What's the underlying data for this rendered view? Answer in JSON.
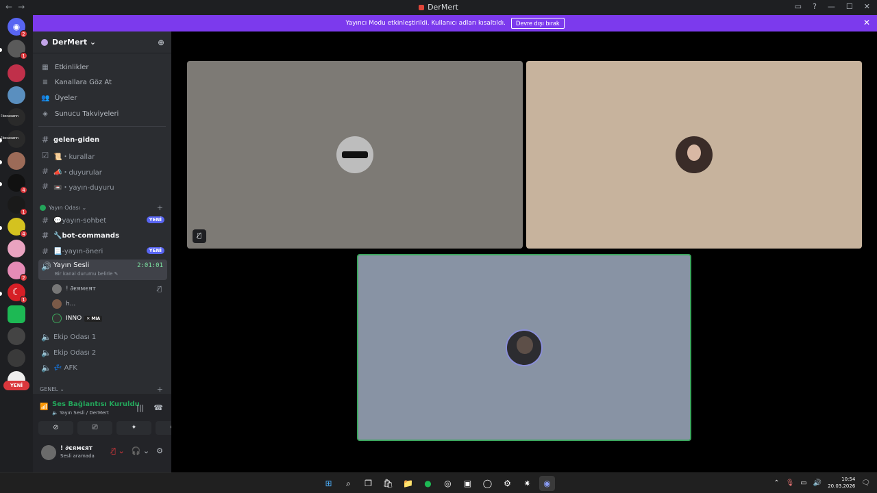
{
  "window": {
    "title": "DerMert",
    "back": "←",
    "forward": "→",
    "inbox_icon": "inbox-icon",
    "help": "?",
    "minimize": "—",
    "maximize": "☐",
    "close": "✕"
  },
  "banner": {
    "message": "Yayıncı Modu etkinleştirildi. Kullanıcı adları kısaltıldı.",
    "button": "Devre dışı bırak",
    "close": "✕",
    "color": "#7c3aed"
  },
  "servers": {
    "badges": [
      "2",
      "1",
      "4",
      "1",
      "4",
      "2",
      "1"
    ],
    "label_small": "ﾐkocasann",
    "label_small2": "ﾐkocasann",
    "yeni": "YENİ"
  },
  "guild": {
    "name": "DerMert ⌄",
    "add_user_icon": "add-user-icon"
  },
  "nav": [
    {
      "icon": "▦",
      "label": "Etkinlikler"
    },
    {
      "icon": "≣",
      "label": "Kanallara Göz At"
    },
    {
      "icon": "👥",
      "label": "Üyeler"
    },
    {
      "icon": "◈",
      "label": "Sunucu Takviyeleri"
    }
  ],
  "channels": {
    "gelen": "gelen-giden",
    "kurallar": "📜・kurallar",
    "duyurular": "📣・duyurular",
    "yayin_duyuru": "📼・yayın-duyuru",
    "category_yayin": "Yayın Odası ⌄",
    "yayin_sohbet": "💬yayın-sohbet",
    "bot_commands": "🔧bot-commands",
    "yayin_oneri": "📃-yayın-öneri",
    "new_tag": "YENİ",
    "yayin_sesli": "Yayın Sesli",
    "yayin_sesli_timer": "2:01:01",
    "yayin_sesli_status": "Bir kanal durumu belirle ✎",
    "voice_users": [
      {
        "name": "! ∂єямєят",
        "tag": ""
      },
      {
        "name": "h...",
        "tag": ""
      },
      {
        "name": "INNO",
        "tag": "✕ MIA"
      }
    ],
    "ekip1": "Ekip Odası 1",
    "ekip2": "Ekip Odası 2",
    "afk": "💤 AFK",
    "category_genel": "GENEL ⌄"
  },
  "voicebar": {
    "status": "Ses Bağlantısı Kuruldu",
    "sub": "🔈 Yayın Sesli / DerMert"
  },
  "user": {
    "name": "! ∂єямєят",
    "status": "Sesli aramada"
  },
  "stage": {
    "colors": [
      "#7d7a75",
      "#c7b39d",
      "#8893a4"
    ],
    "active_border": "#3ba55d"
  },
  "taskbar": {
    "time": "10:54",
    "date": "20.03.2026"
  }
}
